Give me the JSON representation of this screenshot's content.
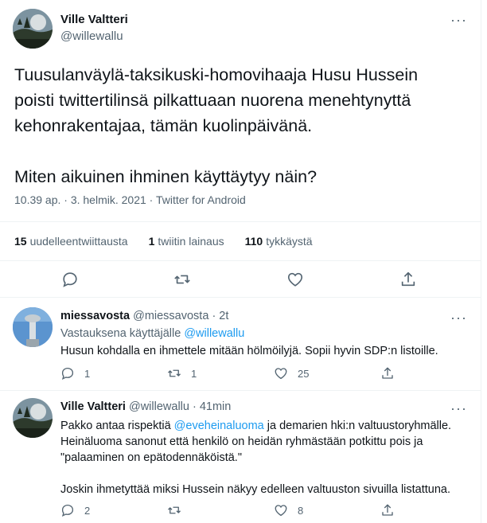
{
  "main_tweet": {
    "author_name": "Ville Valtteri",
    "author_handle": "@willewallu",
    "text_line1": "Tuusulanväylä-taksikuski-homovihaaja Husu Hussein",
    "text_line2": "poisti twittertilinsä pilkattuaan nuorena menehtynyttä",
    "text_line3": "kehonrakentajaa, tämän kuolinpäivänä.",
    "text_line4": "Miten aikuinen ihminen käyttäytyy näin?",
    "timestamp": "10.39 ap. · 3. helmik. 2021",
    "source": "Twitter for Android",
    "separator": " · ",
    "stats": {
      "retweets_count": "15",
      "retweets_label": "uudelleentwiittausta",
      "quotes_count": "1",
      "quotes_label": "twiitin lainaus",
      "likes_count": "110",
      "likes_label": "tykkäystä"
    }
  },
  "replies": [
    {
      "author_name": "miessavosta",
      "author_handle": "@miessavosta",
      "time": "· 2t",
      "replying_prefix": "Vastauksena käyttäjälle",
      "replying_to": "@willewallu",
      "text": "Husun kohdalla en ihmettele mitään hölmöilyjä. Sopii hyvin SDP:n listoille.",
      "reply_count": "1",
      "retweet_count": "1",
      "like_count": "25"
    },
    {
      "author_name": "Ville Valtteri",
      "author_handle": "@willewallu",
      "time": "· 41min",
      "text_pre": "Pakko antaa rispektiä ",
      "text_mention": "@eveheinaluoma",
      "text_post": " ja demarien hki:n valtuustoryhmälle.",
      "text_line2": "Heinäluoma sanonut että henkilö on heidän ryhmästään potkittu pois ja",
      "text_line3": "\"palaaminen on epätodennäköistä.\"",
      "text_line4": "Joskin ihmetyttää miksi Hussein näkyy edelleen valtuuston sivuilla listattuna.",
      "reply_count": "2",
      "retweet_count": "",
      "like_count": "8"
    }
  ],
  "colors": {
    "text": "#0f1419",
    "secondary": "#536471",
    "link": "#1d9bf0",
    "divider": "#eff3f4"
  }
}
